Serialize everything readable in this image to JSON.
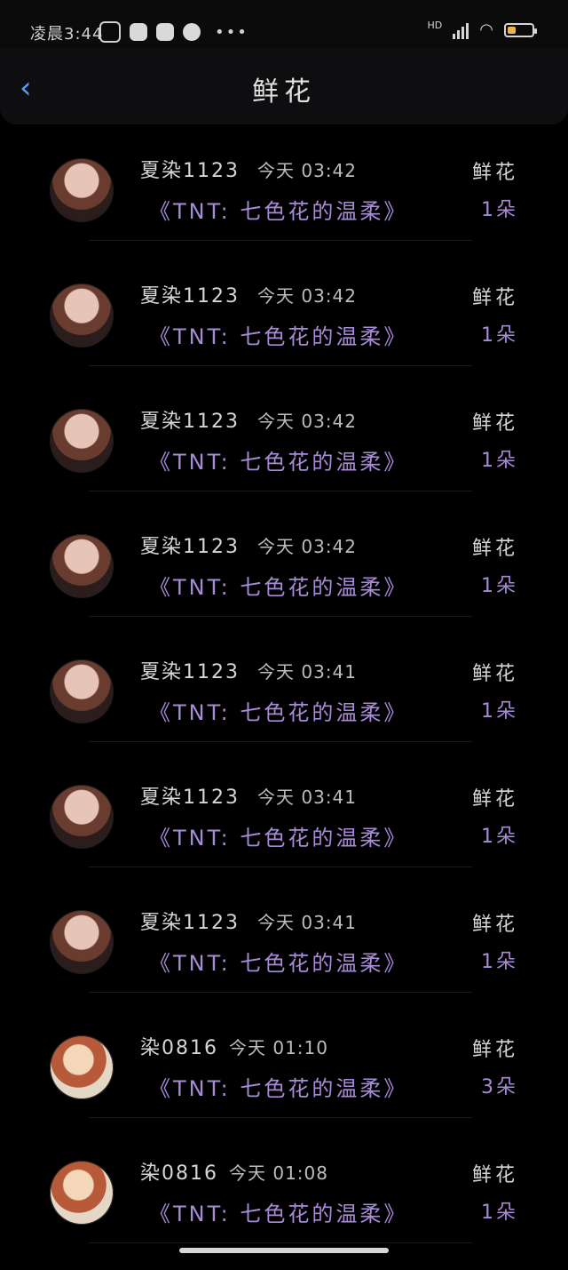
{
  "status": {
    "time": "凌晨3:44",
    "dots": "•••",
    "network": "HD",
    "icons": [
      "mute-icon",
      "app-icon-1",
      "app-icon-2",
      "tiktok-icon",
      "signal-icon",
      "wifi-icon",
      "battery-icon"
    ],
    "battery_level": 0.3
  },
  "header": {
    "back_icon": "back-arrow-icon",
    "title": "鲜花"
  },
  "rows": [
    {
      "name": "夏染1123",
      "time": "今天 03:42",
      "gift": "鲜花",
      "desc": "《TNT: 七色花的温柔》",
      "count": "1朵"
    },
    {
      "name": "夏染1123",
      "time": "今天 03:42",
      "gift": "鲜花",
      "desc": "《TNT: 七色花的温柔》",
      "count": "1朵"
    },
    {
      "name": "夏染1123",
      "time": "今天 03:42",
      "gift": "鲜花",
      "desc": "《TNT: 七色花的温柔》",
      "count": "1朵"
    },
    {
      "name": "夏染1123",
      "time": "今天 03:42",
      "gift": "鲜花",
      "desc": "《TNT: 七色花的温柔》",
      "count": "1朵"
    },
    {
      "name": "夏染1123",
      "time": "今天 03:41",
      "gift": "鲜花",
      "desc": "《TNT: 七色花的温柔》",
      "count": "1朵"
    },
    {
      "name": "夏染1123",
      "time": "今天 03:41",
      "gift": "鲜花",
      "desc": "《TNT: 七色花的温柔》",
      "count": "1朵"
    },
    {
      "name": "夏染1123",
      "time": "今天 03:41",
      "gift": "鲜花",
      "desc": "《TNT: 七色花的温柔》",
      "count": "1朵"
    },
    {
      "name": "染0816",
      "time": "今天 01:10",
      "gift": "鲜花",
      "desc": "《TNT: 七色花的温柔》",
      "count": "3朵"
    },
    {
      "name": "染0816",
      "time": "今天 01:08",
      "gift": "鲜花",
      "desc": "《TNT: 七色花的温柔》",
      "count": "1朵"
    }
  ]
}
